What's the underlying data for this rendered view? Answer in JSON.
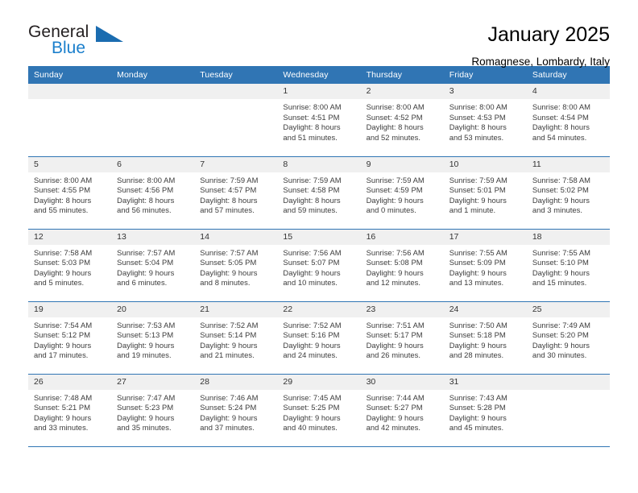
{
  "logo": {
    "word_one": "General",
    "word_two": "Blue",
    "triangle_icon": "triangle-icon",
    "accent_color": "#1b6cb0"
  },
  "header": {
    "title": "January 2025",
    "subtitle": "Romagnese, Lombardy, Italy"
  },
  "theme": {
    "header_blue": "#3075b4",
    "daynum_gray": "#f0f0f0",
    "text_color": "#3b3b3b"
  },
  "calendar": {
    "weekday_headers": [
      "Sunday",
      "Monday",
      "Tuesday",
      "Wednesday",
      "Thursday",
      "Friday",
      "Saturday"
    ],
    "weeks": [
      [
        {
          "day": "",
          "sunrise": "",
          "sunset": "",
          "daylight_line1": "",
          "daylight_line2": ""
        },
        {
          "day": "",
          "sunrise": "",
          "sunset": "",
          "daylight_line1": "",
          "daylight_line2": ""
        },
        {
          "day": "",
          "sunrise": "",
          "sunset": "",
          "daylight_line1": "",
          "daylight_line2": ""
        },
        {
          "day": "1",
          "sunrise": "Sunrise: 8:00 AM",
          "sunset": "Sunset: 4:51 PM",
          "daylight_line1": "Daylight: 8 hours",
          "daylight_line2": "and 51 minutes."
        },
        {
          "day": "2",
          "sunrise": "Sunrise: 8:00 AM",
          "sunset": "Sunset: 4:52 PM",
          "daylight_line1": "Daylight: 8 hours",
          "daylight_line2": "and 52 minutes."
        },
        {
          "day": "3",
          "sunrise": "Sunrise: 8:00 AM",
          "sunset": "Sunset: 4:53 PM",
          "daylight_line1": "Daylight: 8 hours",
          "daylight_line2": "and 53 minutes."
        },
        {
          "day": "4",
          "sunrise": "Sunrise: 8:00 AM",
          "sunset": "Sunset: 4:54 PM",
          "daylight_line1": "Daylight: 8 hours",
          "daylight_line2": "and 54 minutes."
        }
      ],
      [
        {
          "day": "5",
          "sunrise": "Sunrise: 8:00 AM",
          "sunset": "Sunset: 4:55 PM",
          "daylight_line1": "Daylight: 8 hours",
          "daylight_line2": "and 55 minutes."
        },
        {
          "day": "6",
          "sunrise": "Sunrise: 8:00 AM",
          "sunset": "Sunset: 4:56 PM",
          "daylight_line1": "Daylight: 8 hours",
          "daylight_line2": "and 56 minutes."
        },
        {
          "day": "7",
          "sunrise": "Sunrise: 7:59 AM",
          "sunset": "Sunset: 4:57 PM",
          "daylight_line1": "Daylight: 8 hours",
          "daylight_line2": "and 57 minutes."
        },
        {
          "day": "8",
          "sunrise": "Sunrise: 7:59 AM",
          "sunset": "Sunset: 4:58 PM",
          "daylight_line1": "Daylight: 8 hours",
          "daylight_line2": "and 59 minutes."
        },
        {
          "day": "9",
          "sunrise": "Sunrise: 7:59 AM",
          "sunset": "Sunset: 4:59 PM",
          "daylight_line1": "Daylight: 9 hours",
          "daylight_line2": "and 0 minutes."
        },
        {
          "day": "10",
          "sunrise": "Sunrise: 7:59 AM",
          "sunset": "Sunset: 5:01 PM",
          "daylight_line1": "Daylight: 9 hours",
          "daylight_line2": "and 1 minute."
        },
        {
          "day": "11",
          "sunrise": "Sunrise: 7:58 AM",
          "sunset": "Sunset: 5:02 PM",
          "daylight_line1": "Daylight: 9 hours",
          "daylight_line2": "and 3 minutes."
        }
      ],
      [
        {
          "day": "12",
          "sunrise": "Sunrise: 7:58 AM",
          "sunset": "Sunset: 5:03 PM",
          "daylight_line1": "Daylight: 9 hours",
          "daylight_line2": "and 5 minutes."
        },
        {
          "day": "13",
          "sunrise": "Sunrise: 7:57 AM",
          "sunset": "Sunset: 5:04 PM",
          "daylight_line1": "Daylight: 9 hours",
          "daylight_line2": "and 6 minutes."
        },
        {
          "day": "14",
          "sunrise": "Sunrise: 7:57 AM",
          "sunset": "Sunset: 5:05 PM",
          "daylight_line1": "Daylight: 9 hours",
          "daylight_line2": "and 8 minutes."
        },
        {
          "day": "15",
          "sunrise": "Sunrise: 7:56 AM",
          "sunset": "Sunset: 5:07 PM",
          "daylight_line1": "Daylight: 9 hours",
          "daylight_line2": "and 10 minutes."
        },
        {
          "day": "16",
          "sunrise": "Sunrise: 7:56 AM",
          "sunset": "Sunset: 5:08 PM",
          "daylight_line1": "Daylight: 9 hours",
          "daylight_line2": "and 12 minutes."
        },
        {
          "day": "17",
          "sunrise": "Sunrise: 7:55 AM",
          "sunset": "Sunset: 5:09 PM",
          "daylight_line1": "Daylight: 9 hours",
          "daylight_line2": "and 13 minutes."
        },
        {
          "day": "18",
          "sunrise": "Sunrise: 7:55 AM",
          "sunset": "Sunset: 5:10 PM",
          "daylight_line1": "Daylight: 9 hours",
          "daylight_line2": "and 15 minutes."
        }
      ],
      [
        {
          "day": "19",
          "sunrise": "Sunrise: 7:54 AM",
          "sunset": "Sunset: 5:12 PM",
          "daylight_line1": "Daylight: 9 hours",
          "daylight_line2": "and 17 minutes."
        },
        {
          "day": "20",
          "sunrise": "Sunrise: 7:53 AM",
          "sunset": "Sunset: 5:13 PM",
          "daylight_line1": "Daylight: 9 hours",
          "daylight_line2": "and 19 minutes."
        },
        {
          "day": "21",
          "sunrise": "Sunrise: 7:52 AM",
          "sunset": "Sunset: 5:14 PM",
          "daylight_line1": "Daylight: 9 hours",
          "daylight_line2": "and 21 minutes."
        },
        {
          "day": "22",
          "sunrise": "Sunrise: 7:52 AM",
          "sunset": "Sunset: 5:16 PM",
          "daylight_line1": "Daylight: 9 hours",
          "daylight_line2": "and 24 minutes."
        },
        {
          "day": "23",
          "sunrise": "Sunrise: 7:51 AM",
          "sunset": "Sunset: 5:17 PM",
          "daylight_line1": "Daylight: 9 hours",
          "daylight_line2": "and 26 minutes."
        },
        {
          "day": "24",
          "sunrise": "Sunrise: 7:50 AM",
          "sunset": "Sunset: 5:18 PM",
          "daylight_line1": "Daylight: 9 hours",
          "daylight_line2": "and 28 minutes."
        },
        {
          "day": "25",
          "sunrise": "Sunrise: 7:49 AM",
          "sunset": "Sunset: 5:20 PM",
          "daylight_line1": "Daylight: 9 hours",
          "daylight_line2": "and 30 minutes."
        }
      ],
      [
        {
          "day": "26",
          "sunrise": "Sunrise: 7:48 AM",
          "sunset": "Sunset: 5:21 PM",
          "daylight_line1": "Daylight: 9 hours",
          "daylight_line2": "and 33 minutes."
        },
        {
          "day": "27",
          "sunrise": "Sunrise: 7:47 AM",
          "sunset": "Sunset: 5:23 PM",
          "daylight_line1": "Daylight: 9 hours",
          "daylight_line2": "and 35 minutes."
        },
        {
          "day": "28",
          "sunrise": "Sunrise: 7:46 AM",
          "sunset": "Sunset: 5:24 PM",
          "daylight_line1": "Daylight: 9 hours",
          "daylight_line2": "and 37 minutes."
        },
        {
          "day": "29",
          "sunrise": "Sunrise: 7:45 AM",
          "sunset": "Sunset: 5:25 PM",
          "daylight_line1": "Daylight: 9 hours",
          "daylight_line2": "and 40 minutes."
        },
        {
          "day": "30",
          "sunrise": "Sunrise: 7:44 AM",
          "sunset": "Sunset: 5:27 PM",
          "daylight_line1": "Daylight: 9 hours",
          "daylight_line2": "and 42 minutes."
        },
        {
          "day": "31",
          "sunrise": "Sunrise: 7:43 AM",
          "sunset": "Sunset: 5:28 PM",
          "daylight_line1": "Daylight: 9 hours",
          "daylight_line2": "and 45 minutes."
        },
        {
          "day": "",
          "sunrise": "",
          "sunset": "",
          "daylight_line1": "",
          "daylight_line2": ""
        }
      ]
    ]
  }
}
